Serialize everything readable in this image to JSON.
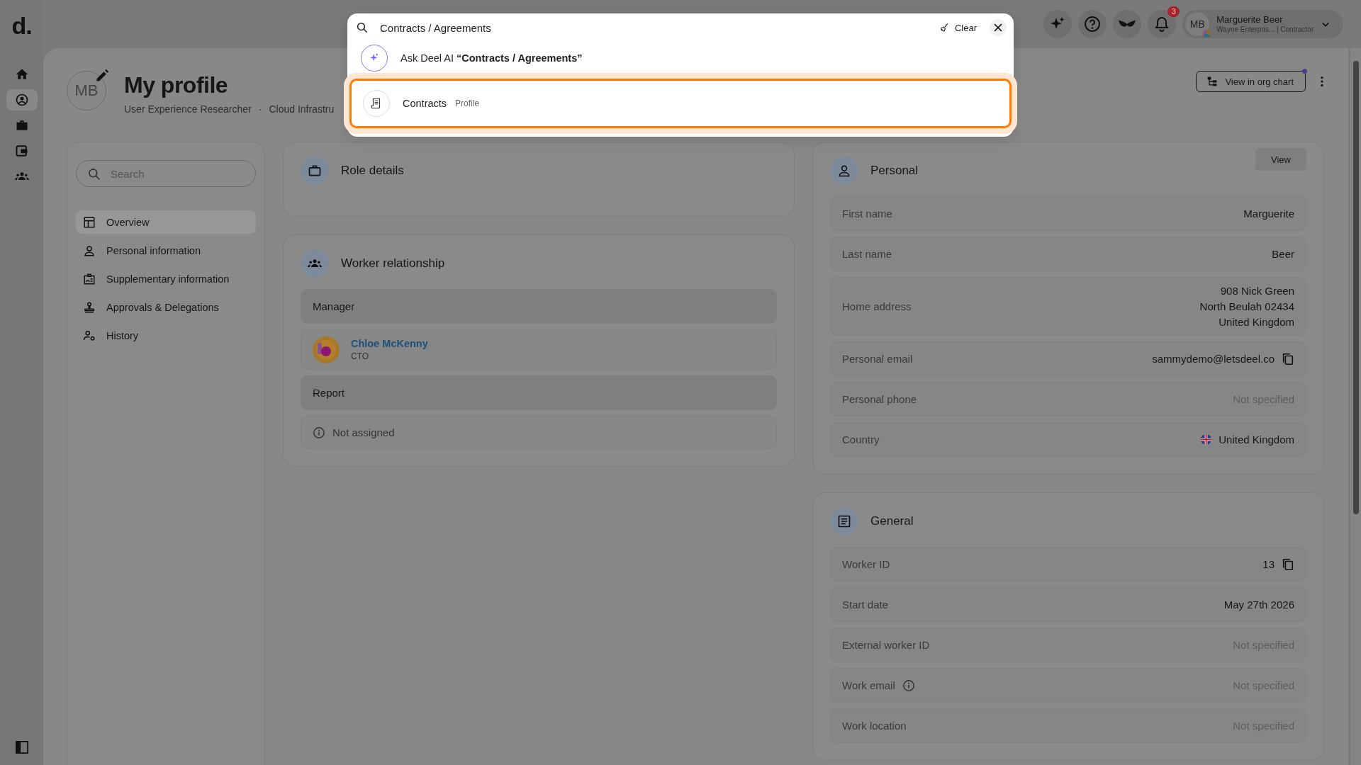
{
  "rail": {
    "logo": "d.",
    "items": [
      {
        "selected": false
      },
      {
        "selected": true
      },
      {
        "selected": false
      },
      {
        "selected": false
      },
      {
        "selected": false
      }
    ]
  },
  "top_bar": {
    "notification_count": "3",
    "user": {
      "initials": "MB",
      "name": "Marguerite Beer",
      "subtitle": "Wayne Enterpris... | Contractor"
    }
  },
  "search_popup": {
    "query": "Contracts / Agreements",
    "clear_label": "Clear",
    "results": [
      {
        "kind": "ai",
        "text": "Ask Deel AI **“Contracts / Agreements”**",
        "selected": false
      },
      {
        "kind": "page",
        "title": "Contracts",
        "tag": "Profile",
        "selected": true
      }
    ]
  },
  "profile": {
    "initials": "MB",
    "title": "My profile",
    "subtitle": [
      "User Experience Researcher",
      "·",
      "Cloud Infrastru"
    ],
    "org_chart_button": "View in org chart"
  },
  "nav": {
    "search_placeholder": "Search",
    "items": [
      {
        "label": "Overview",
        "selected": true
      },
      {
        "label": "Personal information",
        "selected": false
      },
      {
        "label": "Supplementary information",
        "selected": false
      },
      {
        "label": "Approvals & Delegations",
        "selected": false
      },
      {
        "label": "History",
        "selected": false
      }
    ]
  },
  "role_details": {
    "title": "Role details"
  },
  "worker_relationship": {
    "title": "Worker relationship",
    "rows": [
      {
        "kind": "header",
        "label": "Manager"
      },
      {
        "kind": "person",
        "name": "Chloe McKenny",
        "role": "CTO"
      },
      {
        "kind": "header",
        "label": "Report"
      },
      {
        "kind": "empty",
        "label": "Not assigned"
      }
    ]
  },
  "personal": {
    "title": "Personal",
    "view_button": "View",
    "fields": [
      {
        "label": "First name",
        "lines": [
          "Marguerite"
        ],
        "muted": false,
        "copy": false,
        "flag": false,
        "info": false
      },
      {
        "label": "Last name",
        "lines": [
          "Beer"
        ],
        "muted": false,
        "copy": false,
        "flag": false,
        "info": false
      },
      {
        "label": "Home address",
        "lines": [
          "908 Nick Green",
          "North Beulah 02434",
          "United Kingdom"
        ],
        "muted": false,
        "copy": false,
        "flag": false,
        "info": false
      },
      {
        "label": "Personal email",
        "lines": [
          "sammydemo@letsdeel.co"
        ],
        "muted": false,
        "copy": true,
        "flag": false,
        "info": false
      },
      {
        "label": "Personal phone",
        "lines": [
          "Not specified"
        ],
        "muted": true,
        "copy": false,
        "flag": false,
        "info": false
      },
      {
        "label": "Country",
        "lines": [
          "United Kingdom"
        ],
        "muted": false,
        "copy": false,
        "flag": true,
        "info": false
      }
    ]
  },
  "general": {
    "title": "General",
    "fields": [
      {
        "label": "Worker ID",
        "lines": [
          "13"
        ],
        "muted": false,
        "copy": true,
        "flag": false,
        "info": false
      },
      {
        "label": "Start date",
        "lines": [
          "May 27th 2026"
        ],
        "muted": false,
        "copy": false,
        "flag": false,
        "info": false
      },
      {
        "label": "External worker ID",
        "lines": [
          "Not specified"
        ],
        "muted": true,
        "copy": false,
        "flag": false,
        "info": false
      },
      {
        "label": "Work email",
        "lines": [
          "Not specified"
        ],
        "muted": true,
        "copy": false,
        "flag": false,
        "info": true
      },
      {
        "label": "Work location",
        "lines": [
          "Not specified"
        ],
        "muted": true,
        "copy": false,
        "flag": false,
        "info": false
      }
    ]
  }
}
